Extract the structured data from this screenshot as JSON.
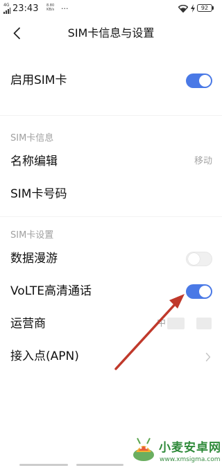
{
  "status_bar": {
    "network": "4G",
    "time": "23:43",
    "speed_value": "8.80",
    "speed_unit": "KB/s",
    "more": "···",
    "battery": "92"
  },
  "header": {
    "title": "SIM卡信息与设置"
  },
  "rows": {
    "enable_sim": {
      "label": "启用SIM卡",
      "enabled": true
    },
    "sim_info_header": "SIM卡信息",
    "name_edit": {
      "label": "名称编辑",
      "value": "移动"
    },
    "sim_number": {
      "label": "SIM卡号码"
    },
    "sim_settings_header": "SIM卡设置",
    "data_roaming": {
      "label": "数据漫游",
      "enabled": false
    },
    "volte": {
      "label": "VoLTE高清通话",
      "enabled": true
    },
    "carrier": {
      "label": "运营商",
      "value_partial": "中"
    },
    "apn": {
      "label": "接入点(APN)"
    }
  },
  "annotation": {
    "arrow_color": "#c0392b",
    "points_to": "volte-toggle"
  },
  "watermark": {
    "name": "小麦安卓网",
    "url": "www.xmsigma.com"
  },
  "colors": {
    "accent": "#4a79e6",
    "section_text": "#a0a0a0"
  }
}
